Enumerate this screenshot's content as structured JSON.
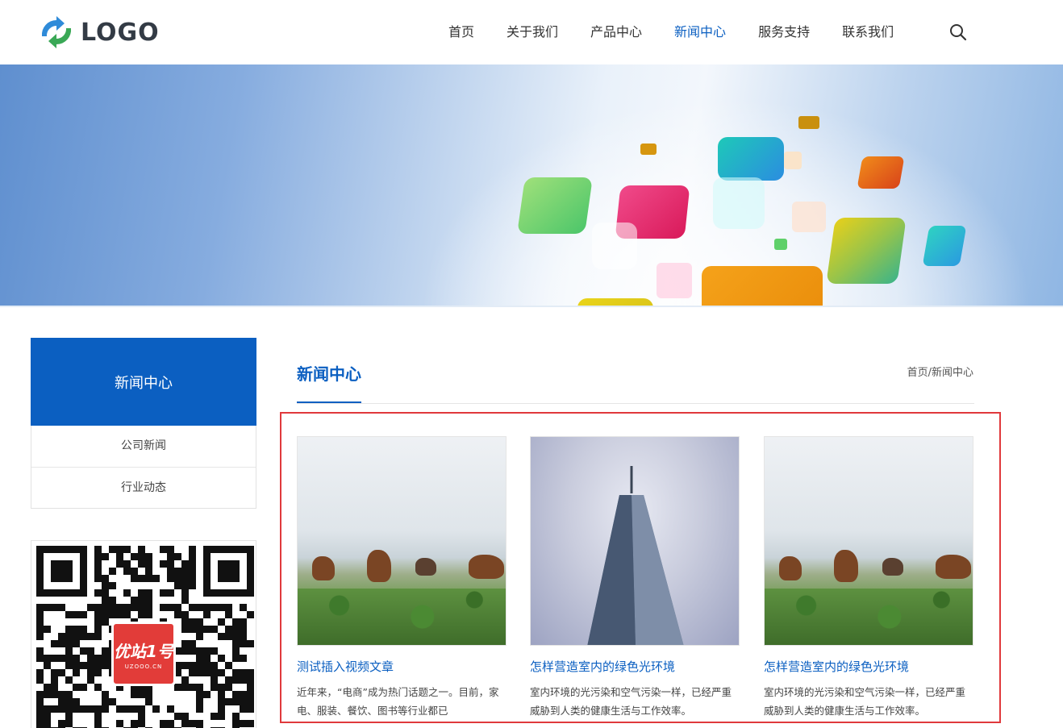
{
  "brand": {
    "logo_text": "LOGO",
    "primary_color": "#0b5fc1"
  },
  "nav": {
    "items": [
      {
        "label": "首页",
        "active": false
      },
      {
        "label": "关于我们",
        "active": false
      },
      {
        "label": "产品中心",
        "active": false
      },
      {
        "label": "新闻中心",
        "active": true
      },
      {
        "label": "服务支持",
        "active": false
      },
      {
        "label": "联系我们",
        "active": false
      }
    ],
    "search_icon": "search-icon"
  },
  "sidebar": {
    "title": "新闻中心",
    "items": [
      {
        "label": "公司新闻"
      },
      {
        "label": "行业动态"
      }
    ],
    "qr_badge_main": "优站1号",
    "qr_badge_sub": "UZOOO.CN"
  },
  "main": {
    "title": "新闻中心",
    "breadcrumb": "首页/新闻中心",
    "highlight_color": "#e0393c",
    "cards": [
      {
        "title": "测试插入视频文章",
        "desc": "近年来，“电商”成为热门话题之一。目前，家电、服装、餐饮、图书等行业都已",
        "image": "horses-on-grassland"
      },
      {
        "title": "怎样营造室内的绿色光环境",
        "desc": "室内环境的光污染和空气污染一样，已经严重威胁到人类的健康生活与工作效率。",
        "image": "skyscraper"
      },
      {
        "title": "怎样营造室内的绿色光环境",
        "desc": "室内环境的光污染和空气污染一样，已经严重威胁到人类的健康生活与工作效率。",
        "image": "horses-on-grassland"
      }
    ]
  }
}
